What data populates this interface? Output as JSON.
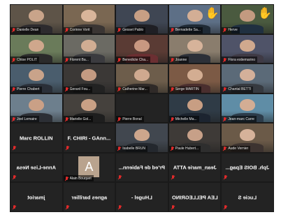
{
  "meeting": {
    "video_tiles": [
      {
        "label": "Danielle Dean",
        "bg": "#5e5448",
        "skin": "#c9a48a",
        "shirt": "#2d2b2e"
      },
      {
        "label": "Corinne Vorit",
        "bg": "#7a6752",
        "skin": "#d9b59a",
        "shirt": "#3a3533"
      },
      {
        "label": "Gesset Pablo",
        "bg": "#3f4653",
        "skin": "#c79f84",
        "shirt": "#1f1f24"
      },
      {
        "label": "Bernadette Sa...",
        "bg": "#5d6f86",
        "skin": "#d3ae95",
        "shirt": "#1f2a35",
        "hand": true
      },
      {
        "label": "Herve",
        "bg": "#4a5a3f",
        "skin": "#c39a80",
        "shirt": "#203040",
        "hand": true,
        "active": true
      },
      {
        "label": "Chloe POLIT",
        "bg": "#6a7b5a",
        "skin": "#cfa78c",
        "shirt": "#2b2b2b"
      },
      {
        "label": "Florent Ba...",
        "bg": "#6b6a63",
        "skin": "#d1ad93",
        "shirt": "#3b3b3f"
      },
      {
        "label": "Benedicte Cha...",
        "bg": "#5a3b34",
        "skin": "#c89881",
        "shirt": "#6b2f32"
      },
      {
        "label": "Joanne",
        "bg": "#8a7d6d",
        "skin": "#d6b39a",
        "shirt": "#2c3038"
      },
      {
        "label": "Flora estiemarino",
        "bg": "#4f5368",
        "skin": "#d0a98e",
        "shirt": "#3f3a45"
      },
      {
        "label": "Pierre Chabert",
        "bg": "#4a5d6d",
        "skin": "#c9a38a",
        "shirt": "#2a2f38"
      },
      {
        "label": "Gerard Fou...",
        "bg": "#3b3836",
        "skin": "#c49b82",
        "shirt": "#222"
      },
      {
        "label": "Catherine Mar...",
        "bg": "#6d5d4b",
        "skin": "#cfa98f",
        "shirt": "#2f2a28"
      },
      {
        "label": "Serge MARTIN",
        "bg": "#7c5a45",
        "skin": "#d3ad92",
        "shirt": "#4a2e2e"
      },
      {
        "label": "Chantal BETTI",
        "bg": "#5b6a78",
        "skin": "#d4b09a",
        "shirt": "#363a40"
      },
      {
        "label": "Joel Lemaire",
        "bg": "#6d7f8d",
        "skin": "#caa086",
        "shirt": "#2c2f35"
      },
      {
        "label": "Marielle Gol...",
        "bg": "#45413d",
        "skin": "#c9a085",
        "shirt": "#1e1e1e"
      },
      {
        "label": "Michelle Ma...",
        "bg": "#2f3b46",
        "skin": "#c89e83",
        "shirt": "#1c2430"
      },
      {
        "label": "Jean-marc Carre",
        "bg": "#5f8da6",
        "skin": "#d3ad94",
        "shirt": "#2c3c4a"
      },
      {
        "label": "Isabelle BRUN",
        "bg": "#41474f",
        "skin": "#cda68c",
        "shirt": "#24282e"
      },
      {
        "label": "Paule Hubert...",
        "bg": "#3e3a37",
        "skin": "#c7a088",
        "shirt": "#2e2e2e"
      },
      {
        "label": "Aude Vernier",
        "bg": "#6b5a48",
        "skin": "#d6b29a",
        "shirt": "#3d3330"
      }
    ],
    "name_tiles": [
      "Marc ROLLIN",
      "F. CHIRI - GAnn...",
      "Anne-Lise Nesa",
      "Pr'ed de Fabienn...",
      "Jean_marie ATTA",
      "Jph. BOIS Epag...",
      "jmariot",
      "agnes barillier",
      "LHugel -",
      "LEA PELLEGRINO",
      "Lucie S"
    ],
    "avatar_tile": {
      "initial": "A",
      "label": "Alain Bouquet"
    },
    "muted_empty_label": "Pierre Bonal",
    "raise_hand_icon": "raised-hand-icon",
    "muted_icon": "muted-mic-icon",
    "active_border_color": "#d4d83a",
    "muted_color": "#e02a2a"
  }
}
